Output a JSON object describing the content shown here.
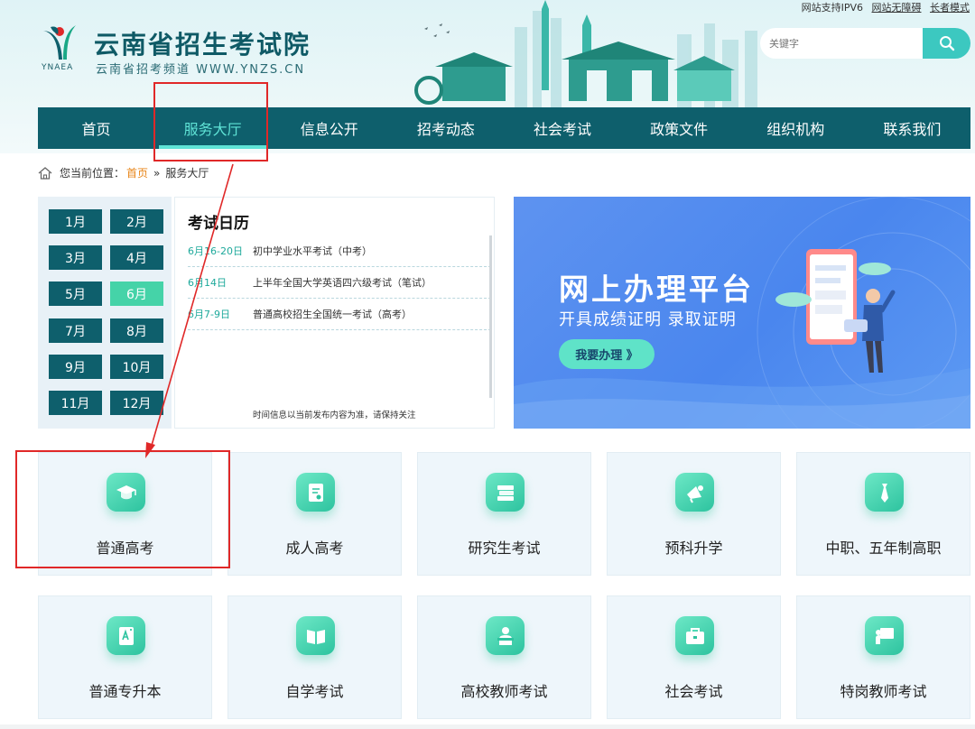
{
  "topbar": {
    "ipv6": "网站支持IPV6",
    "accessible": "网站无障碍",
    "elder": "长者模式"
  },
  "logo": {
    "title": "云南省招生考试院",
    "url": "云南省招考频道 WWW.YNZS.CN",
    "abbr": "YNAEA"
  },
  "search": {
    "placeholder": "关键字",
    "icon": "search-icon"
  },
  "nav": {
    "items": [
      {
        "label": "首页"
      },
      {
        "label": "服务大厅",
        "active": true
      },
      {
        "label": "信息公开"
      },
      {
        "label": "招考动态"
      },
      {
        "label": "社会考试"
      },
      {
        "label": "政策文件"
      },
      {
        "label": "组织机构"
      },
      {
        "label": "联系我们"
      }
    ]
  },
  "breadcrumb": {
    "prefix": "您当前位置：",
    "home": "首页",
    "sep": "»",
    "current": "服务大厅"
  },
  "calendar": {
    "months": [
      "1月",
      "2月",
      "3月",
      "4月",
      "5月",
      "6月",
      "7月",
      "8月",
      "9月",
      "10月",
      "11月",
      "12月"
    ],
    "selected": "6月",
    "title": "考试日历",
    "events": [
      {
        "date": "6月16-20日",
        "name": "初中学业水平考试（中考）"
      },
      {
        "date": "6月14日",
        "name": "上半年全国大学英语四六级考试（笔试）"
      },
      {
        "date": "6月7-9日",
        "name": "普通高校招生全国统一考试（高考）"
      }
    ],
    "note": "时间信息以当前发布内容为准，请保持关注"
  },
  "banner": {
    "title": "网上办理平台",
    "subtitle": "开具成绩证明 录取证明",
    "button": "我要办理 》"
  },
  "services": [
    {
      "label": "普通高考",
      "icon": "graduation-cap-icon"
    },
    {
      "label": "成人高考",
      "icon": "scroll-certificate-icon"
    },
    {
      "label": "研究生考试",
      "icon": "book-stack-icon"
    },
    {
      "label": "预科升学",
      "icon": "megaphone-icon"
    },
    {
      "label": "中职、五年制高职",
      "icon": "necktie-icon"
    },
    {
      "label": "普通专升本",
      "icon": "grade-paper-icon"
    },
    {
      "label": "自学考试",
      "icon": "open-book-icon"
    },
    {
      "label": "高校教师考试",
      "icon": "teacher-icon"
    },
    {
      "label": "社会考试",
      "icon": "briefcase-icon"
    },
    {
      "label": "特岗教师考试",
      "icon": "teaching-board-icon"
    }
  ],
  "colors": {
    "nav_bg": "#0e5f6c",
    "accent": "#5fe3d6",
    "highlight_red": "#e02828",
    "breadcrumb_home": "#e8861a",
    "tile_icon": "#3dd0ad"
  }
}
